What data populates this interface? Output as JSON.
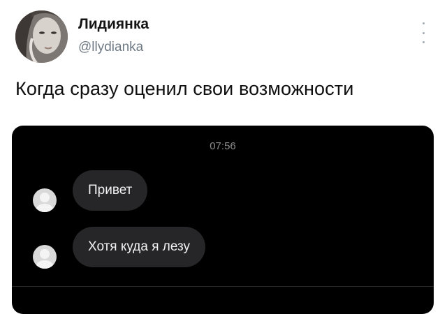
{
  "tweet": {
    "display_name": "Лидиянка",
    "handle": "@llydianka",
    "text": "Когда сразу оценил свои возможности",
    "more_icon": "more-vertical-icon"
  },
  "chat_screenshot": {
    "time": "07:56",
    "messages": [
      {
        "text": "Привет"
      },
      {
        "text": "Хотя куда я лезу"
      }
    ]
  }
}
